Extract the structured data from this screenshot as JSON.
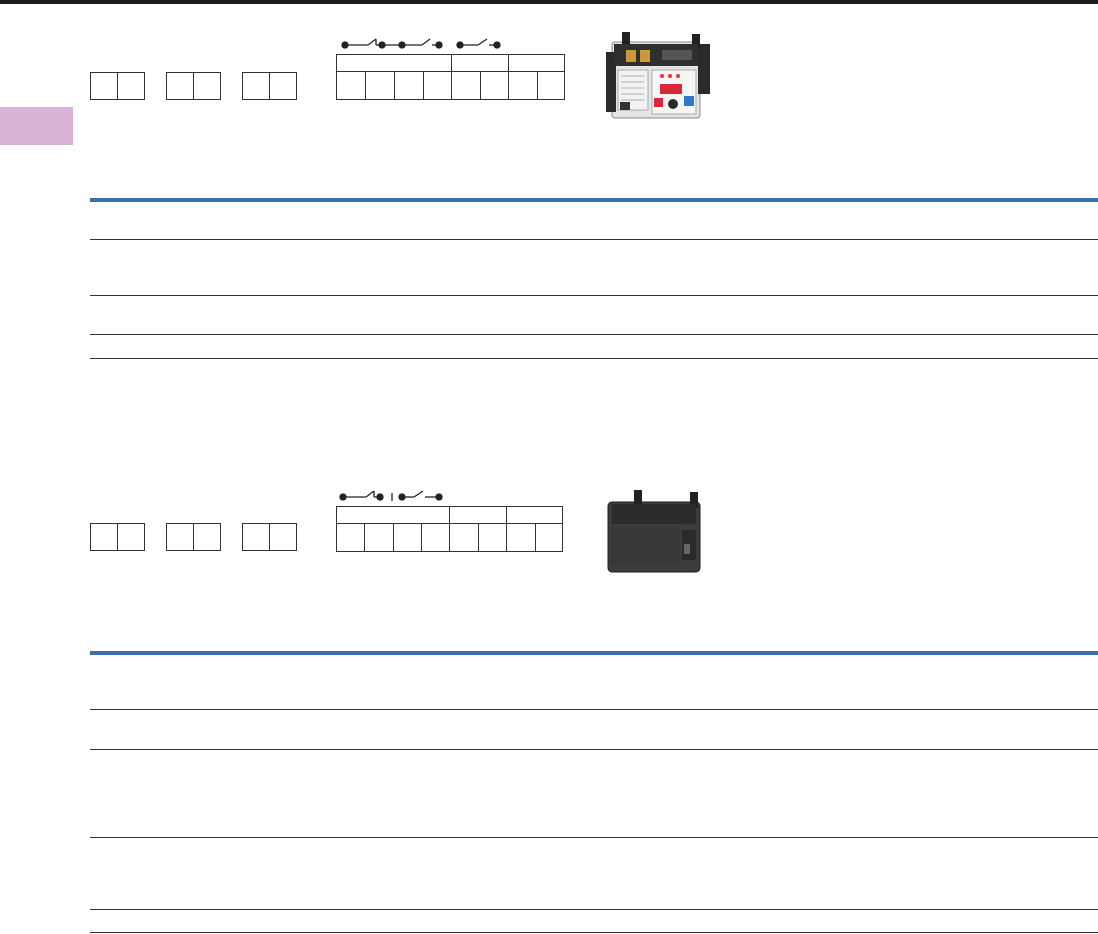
{
  "page": {
    "section_tab_color": "#d8b3d6",
    "accent_rule_color": "#3c6faa"
  },
  "section1": {
    "ordering_cells_groups": [
      2,
      2,
      2
    ],
    "contact_symbols": [
      "nc-contact-symbol",
      "no-contact-symbol",
      "no-contact-symbol"
    ],
    "product_image": "motor-insulation-relay-with-display",
    "table_rows": [
      "",
      "",
      "",
      ""
    ]
  },
  "section2": {
    "ordering_cells_groups": [
      2,
      2,
      2
    ],
    "contact_symbols": [
      "nc-contact-symbol",
      "no-contact-symbol"
    ],
    "product_image": "motor-insulation-relay-covered",
    "table_rows": [
      "",
      "",
      "",
      "",
      "",
      ""
    ]
  }
}
